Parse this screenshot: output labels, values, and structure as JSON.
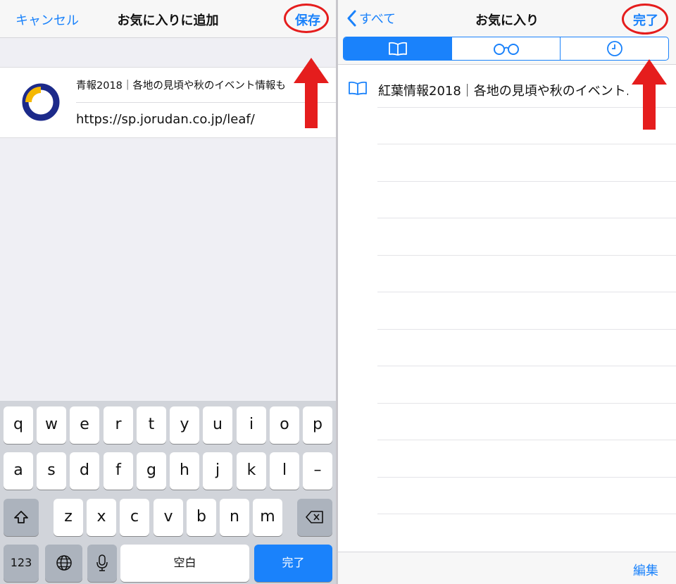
{
  "left": {
    "nav": {
      "cancel": "キャンセル",
      "title": "お気に入りに追加",
      "save": "保存"
    },
    "bookmark": {
      "title": "青報2018｜各地の見頃や秋のイベント情報も",
      "url": "https://sp.jorudan.co.jp/leaf/"
    },
    "keyboard": {
      "row1": [
        "q",
        "w",
        "e",
        "r",
        "t",
        "y",
        "u",
        "i",
        "o",
        "p"
      ],
      "row2": [
        "a",
        "s",
        "d",
        "f",
        "g",
        "h",
        "j",
        "k",
        "l",
        "–"
      ],
      "row3": [
        "z",
        "x",
        "c",
        "v",
        "b",
        "n",
        "m"
      ],
      "numbers": "123",
      "space": "空白",
      "done": "完了"
    }
  },
  "right": {
    "nav": {
      "back": "すべて",
      "title": "お気に入り",
      "done": "完了"
    },
    "segments": [
      "bookmarks-icon",
      "reading-list-icon",
      "history-icon"
    ],
    "bookmarks": [
      "紅葉情報2018｜各地の見頃や秋のイベント…"
    ],
    "toolbar": {
      "edit": "編集"
    }
  },
  "colors": {
    "accent": "#1a82fb",
    "annotation": "#e51d1d",
    "favicon_navy": "#1c2a8a",
    "favicon_yellow": "#f5b800"
  },
  "annotations": {
    "circled": [
      "保存",
      "完了"
    ],
    "arrows": 2
  }
}
